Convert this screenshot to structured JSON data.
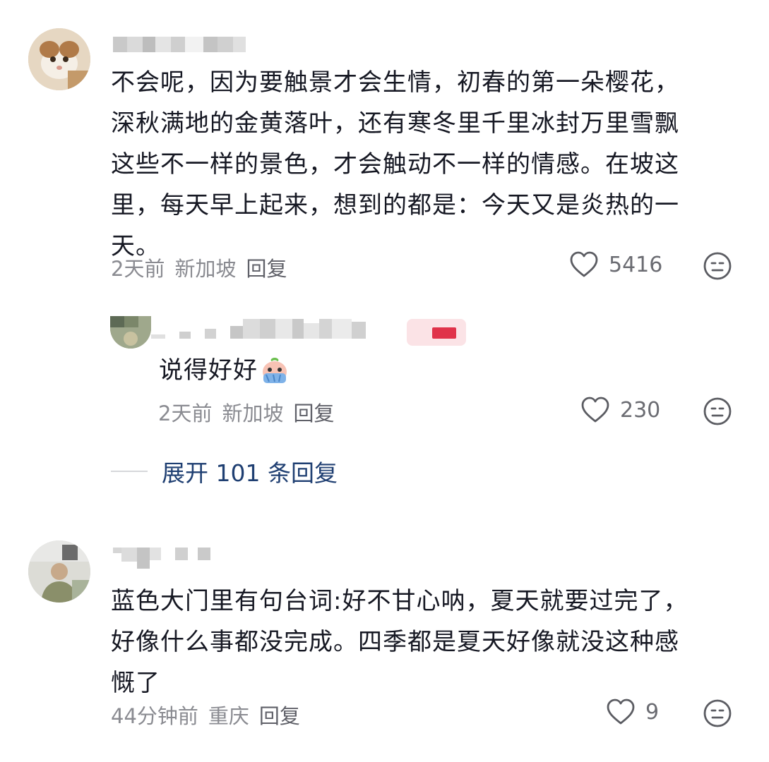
{
  "comments": [
    {
      "text": "不会呢，因为要触景才会生情，初春的第一朵樱花，\n深秋满地的金黄落叶，还有寒冬里千里冰封万里雪飘\n这些不一样的景色，才会触动不一样的情感。在坡这\n里，每天早上起来，想到的都是：今天又是炎热的一\n天。",
      "time": "2天前",
      "location": "新加坡",
      "reply_label": "回复",
      "likes": "5416",
      "avatar_icon": "cat-avatar"
    },
    {
      "text": "说得好好",
      "emoji_icon": "crying-peach-emoji",
      "time": "2天前",
      "location": "新加坡",
      "reply_label": "回复",
      "likes": "230",
      "avatar_icon": "user-avatar"
    },
    {
      "text": "蓝色大门里有句台词:好不甘心呐，夏天就要过完了，\n好像什么事都没完成。四季都是夏天好像就没这种感\n慨了",
      "time": "44分钟前",
      "location": "重庆",
      "reply_label": "回复",
      "likes": "9",
      "avatar_icon": "person-avatar"
    }
  ],
  "expand_replies": "展开 101 条回复",
  "colors": {
    "text": "#161823",
    "meta": "#8a8b91",
    "expand": "#1f3f72",
    "author_badge": "#e0334a"
  },
  "icons": [
    "heart-outline-icon",
    "meh-face-icon"
  ]
}
